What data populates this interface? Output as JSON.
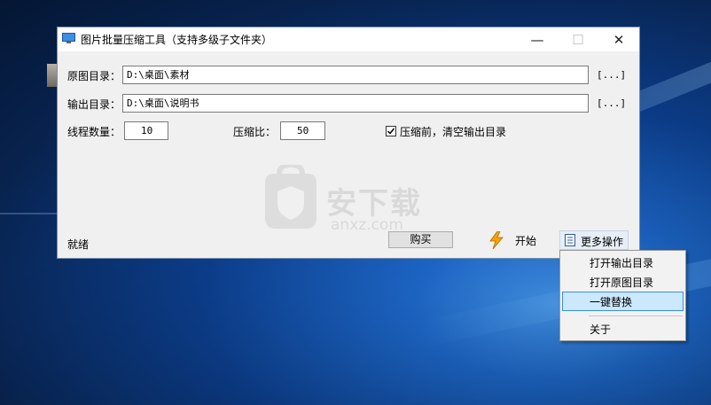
{
  "window": {
    "title": "图片批量压缩工具（支持多级子文件夹）",
    "minimize_glyph": "—",
    "maximize_glyph": "☐",
    "close_glyph": "✕"
  },
  "source_dir": {
    "label": "原图目录：",
    "value": "D:\\桌面\\素材",
    "browse": "[...]"
  },
  "output_dir": {
    "label": "输出目录：",
    "value": "D:\\桌面\\说明书",
    "browse": "[...]"
  },
  "threads": {
    "label": "线程数量：",
    "value": "10"
  },
  "compress_ratio": {
    "label": "压缩比：",
    "value": "50"
  },
  "clear_output": {
    "label": "压缩前，清空输出目录",
    "checked": true
  },
  "watermark": {
    "text": "安下载",
    "sub": "anxz.com"
  },
  "status": "就绪",
  "buy_label": "购买",
  "start": {
    "label": "开始",
    "icon": "lightning-icon"
  },
  "more": {
    "label": "更多操作",
    "icon": "document-icon"
  },
  "menu": {
    "items": [
      "打开输出目录",
      "打开原图目录",
      "一键替换",
      "关于"
    ],
    "highlighted": "一键替换"
  },
  "colors": {
    "accent": "#3b8ee4",
    "highlight": "#cce8ff",
    "bolt": "#f5a300"
  }
}
